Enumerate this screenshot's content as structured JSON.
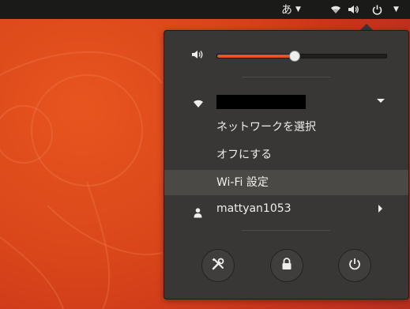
{
  "topbar": {
    "input_method": "あ",
    "icons": [
      "wifi-icon",
      "speaker-icon",
      "power-icon"
    ]
  },
  "volume": {
    "level_percent": 46,
    "icon": "speaker-icon"
  },
  "network": {
    "name_redacted": "",
    "icon": "wifi-icon",
    "items": [
      {
        "label": "ネットワークを選択"
      },
      {
        "label": "オフにする"
      },
      {
        "label": "Wi-Fi 設定"
      }
    ]
  },
  "user": {
    "name": "mattyan1053",
    "icon": "user-icon"
  },
  "actions": [
    "settings-icon",
    "lock-icon",
    "power-icon"
  ],
  "colors": {
    "accent": "#e95420",
    "menu_bg": "#383735",
    "topbar_bg": "#1a1a19"
  }
}
